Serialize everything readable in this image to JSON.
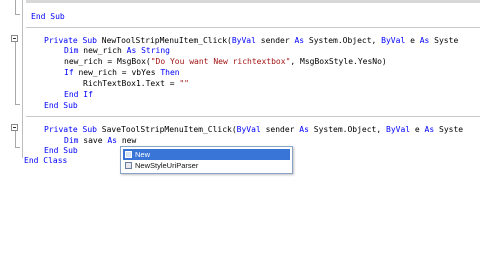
{
  "code_lines": [
    {
      "parts": [
        {
          "t": "End Sub",
          "kw": true
        }
      ]
    },
    {
      "parts": [
        {
          "t": "Private Sub",
          "kw": true
        },
        {
          "t": " NewToolStripMenuItem_Click("
        },
        {
          "t": "ByVal",
          "kw": true
        },
        {
          "t": " sender "
        },
        {
          "t": "As",
          "kw": true
        },
        {
          "t": " System.Object, "
        },
        {
          "t": "ByVal",
          "kw": true
        },
        {
          "t": " e "
        },
        {
          "t": "As",
          "kw": true
        },
        {
          "t": " Syste"
        }
      ]
    },
    {
      "parts": [
        {
          "t": "Dim",
          "kw": true
        },
        {
          "t": " new_rich "
        },
        {
          "t": "As",
          "kw": true
        },
        {
          "t": " String",
          "kw": true
        }
      ]
    },
    {
      "parts": [
        {
          "t": "new_rich = MsgBox("
        },
        {
          "t": "\"Do You want New richtextbox\"",
          "str": true
        },
        {
          "t": ", MsgBoxStyle.YesNo)"
        }
      ]
    },
    {
      "parts": [
        {
          "t": "If",
          "kw": true
        },
        {
          "t": " new_rich = vbYes "
        },
        {
          "t": "Then",
          "kw": true
        }
      ]
    },
    {
      "parts": [
        {
          "t": "RichTextBox1.Text = "
        },
        {
          "t": "\"\"",
          "str": true
        }
      ]
    },
    {
      "parts": [
        {
          "t": "End If",
          "kw": true
        }
      ]
    },
    {
      "parts": [
        {
          "t": "End Sub",
          "kw": true
        }
      ]
    },
    {
      "parts": [
        {
          "t": "Private Sub",
          "kw": true
        },
        {
          "t": " SaveToolStripMenuItem_Click("
        },
        {
          "t": "ByVal",
          "kw": true
        },
        {
          "t": " sender "
        },
        {
          "t": "As",
          "kw": true
        },
        {
          "t": " System.Object, "
        },
        {
          "t": "ByVal",
          "kw": true
        },
        {
          "t": " e "
        },
        {
          "t": "As",
          "kw": true
        },
        {
          "t": " Syste"
        }
      ]
    },
    {
      "parts": [
        {
          "t": "Dim",
          "kw": true
        },
        {
          "t": " save "
        },
        {
          "t": "As",
          "kw": true
        },
        {
          "t": " new"
        }
      ]
    },
    {
      "parts": [
        {
          "t": "End Sub",
          "kw": true
        }
      ]
    },
    {
      "parts": [
        {
          "t": "End Class",
          "kw": true
        }
      ]
    }
  ],
  "intellisense": {
    "items": [
      {
        "label": "New",
        "selected": true,
        "icon": "keyword-icon"
      },
      {
        "label": "NewStyleUriParser",
        "selected": false,
        "icon": "class-icon"
      }
    ]
  },
  "colors": {
    "keyword": "#0000ff",
    "string": "#a31515",
    "selection": "#3875d7"
  }
}
